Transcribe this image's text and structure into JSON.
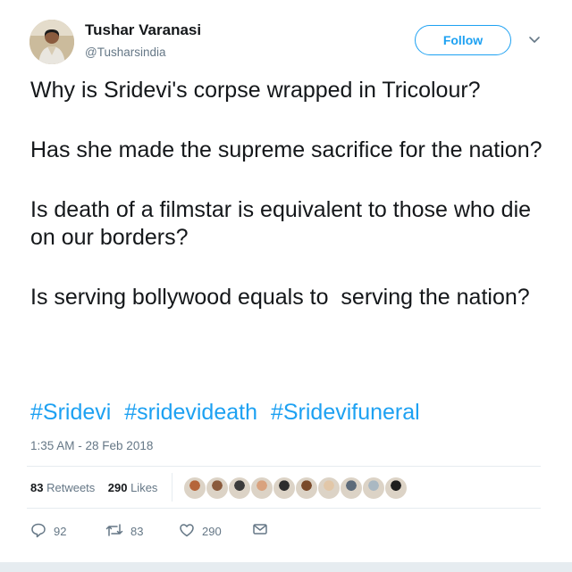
{
  "author": {
    "name": "Tushar Varanasi",
    "handle": "@Tusharsindia",
    "follow_label": "Follow"
  },
  "tweet": {
    "paragraphs": [
      "Why is Sridevi's corpse wrapped in Tricolour?",
      "Has she made the supreme sacrifice for the nation?",
      "Is death of a filmstar is equivalent to those who die on our borders?",
      "Is serving bollywood equals to  serving the nation?"
    ],
    "hashtags": [
      "#Sridevi",
      "#sridevideath",
      "#Sridevifuneral"
    ],
    "timestamp": "1:35 AM - 28 Feb 2018"
  },
  "stats": {
    "retweets_count": "83",
    "retweets_label": "Retweets",
    "likes_count": "290",
    "likes_label": "Likes"
  },
  "liker_avatars": [
    {
      "color": "#b5653a"
    },
    {
      "color": "#8a5a3c"
    },
    {
      "color": "#3b3b3b"
    },
    {
      "color": "#d9a27e"
    },
    {
      "color": "#2d2d2d"
    },
    {
      "color": "#7a4a2a"
    },
    {
      "color": "#e2c7a8"
    },
    {
      "color": "#5d6b7a"
    },
    {
      "color": "#aab8c2"
    },
    {
      "color": "#1e1e1e"
    }
  ],
  "actions": {
    "reply_count": "92",
    "retweet_count": "83",
    "like_count": "290"
  },
  "colors": {
    "accent": "#1da1f2",
    "text": "#14171a",
    "muted": "#657786"
  }
}
